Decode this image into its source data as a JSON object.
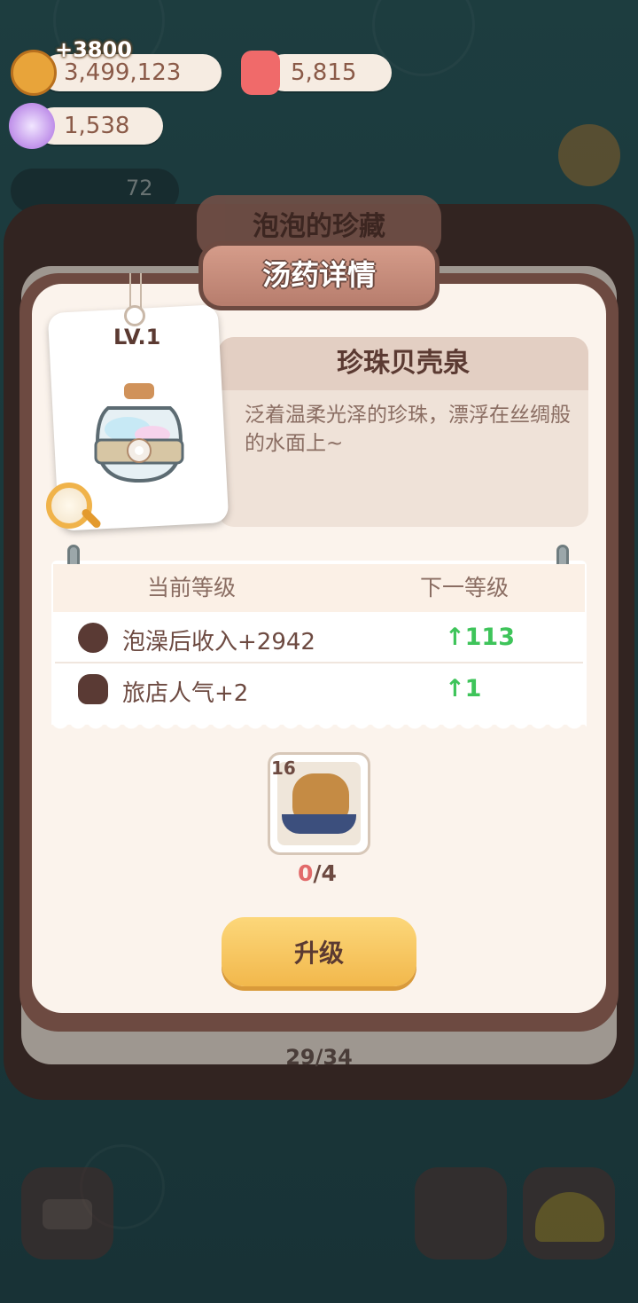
{
  "resources": {
    "cookies": {
      "value": "3,499,123",
      "gain": "+3800",
      "icon": "cookie-icon"
    },
    "gems": {
      "value": "5,815",
      "icon": "red-candy-icon"
    },
    "crystals": {
      "value": "1,538",
      "icon": "purple-crystal-icon"
    }
  },
  "background": {
    "collection_title": "泡泡的珍藏",
    "page": "29/34",
    "side_count": "72"
  },
  "dialog": {
    "title": "汤药详情",
    "level": "LV.1",
    "item_name": "珍珠贝壳泉",
    "item_description": "泛着温柔光泽的珍珠，漂浮在丝绸般的水面上~",
    "table": {
      "col_current": "当前等级",
      "col_next": "下一等级",
      "rows": [
        {
          "icon": "cookie-icon",
          "label": "泡澡后收入+2942",
          "next": "↑113"
        },
        {
          "icon": "popularity-icon",
          "label": "旅店人气+2",
          "next": "↑1"
        }
      ]
    },
    "requirement": {
      "badge": "16",
      "have": "0",
      "need": "/4",
      "icon": "capybara-bath-icon"
    },
    "upgrade_label": "升级"
  }
}
